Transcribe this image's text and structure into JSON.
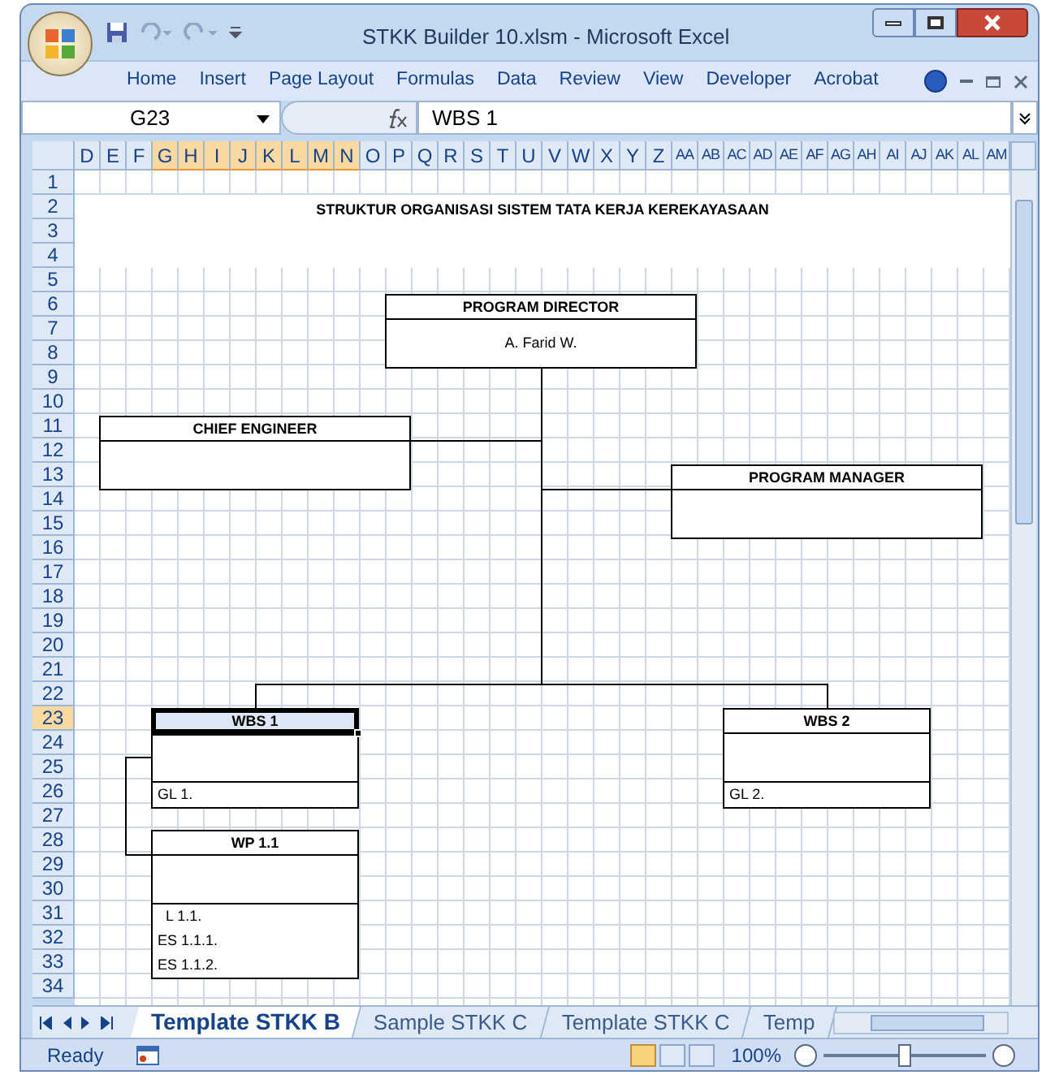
{
  "window": {
    "title": "STKK Builder 10.xlsm  -  Microsoft Excel"
  },
  "ribbon_tabs": [
    {
      "label": "Home"
    },
    {
      "label": "Insert"
    },
    {
      "label": "Page Layout"
    },
    {
      "label": "Formulas"
    },
    {
      "label": "Data"
    },
    {
      "label": "Review"
    },
    {
      "label": "View"
    },
    {
      "label": "Developer"
    },
    {
      "label": "Acrobat"
    }
  ],
  "formula_bar": {
    "name_box": "G23",
    "formula": "WBS 1"
  },
  "columns": [
    {
      "label": "D",
      "selected": false
    },
    {
      "label": "E",
      "selected": false
    },
    {
      "label": "F",
      "selected": false
    },
    {
      "label": "G",
      "selected": true
    },
    {
      "label": "H",
      "selected": true
    },
    {
      "label": "I",
      "selected": true
    },
    {
      "label": "J",
      "selected": true
    },
    {
      "label": "K",
      "selected": true
    },
    {
      "label": "L",
      "selected": true
    },
    {
      "label": "M",
      "selected": true
    },
    {
      "label": "N",
      "selected": true
    },
    {
      "label": "O",
      "selected": false
    },
    {
      "label": "P",
      "selected": false
    },
    {
      "label": "Q",
      "selected": false
    },
    {
      "label": "R",
      "selected": false
    },
    {
      "label": "S",
      "selected": false
    },
    {
      "label": "T",
      "selected": false
    },
    {
      "label": "U",
      "selected": false
    },
    {
      "label": "V",
      "selected": false
    },
    {
      "label": "W",
      "selected": false
    },
    {
      "label": "X",
      "selected": false
    },
    {
      "label": "Y",
      "selected": false
    },
    {
      "label": "Z",
      "selected": false
    },
    {
      "label": "AA",
      "selected": false
    },
    {
      "label": "AB",
      "selected": false
    },
    {
      "label": "AC",
      "selected": false
    },
    {
      "label": "AD",
      "selected": false
    },
    {
      "label": "AE",
      "selected": false
    },
    {
      "label": "AF",
      "selected": false
    },
    {
      "label": "AG",
      "selected": false
    },
    {
      "label": "AH",
      "selected": false
    },
    {
      "label": "AI",
      "selected": false
    },
    {
      "label": "AJ",
      "selected": false
    },
    {
      "label": "AK",
      "selected": false
    },
    {
      "label": "AL",
      "selected": false
    },
    {
      "label": "AM",
      "selected": false
    }
  ],
  "rows": [
    {
      "label": "1",
      "selected": false
    },
    {
      "label": "2",
      "selected": false
    },
    {
      "label": "3",
      "selected": false
    },
    {
      "label": "4",
      "selected": false
    },
    {
      "label": "5",
      "selected": false
    },
    {
      "label": "6",
      "selected": false
    },
    {
      "label": "7",
      "selected": false
    },
    {
      "label": "8",
      "selected": false
    },
    {
      "label": "9",
      "selected": false
    },
    {
      "label": "10",
      "selected": false
    },
    {
      "label": "11",
      "selected": false
    },
    {
      "label": "12",
      "selected": false
    },
    {
      "label": "13",
      "selected": false
    },
    {
      "label": "14",
      "selected": false
    },
    {
      "label": "15",
      "selected": false
    },
    {
      "label": "16",
      "selected": false
    },
    {
      "label": "17",
      "selected": false
    },
    {
      "label": "18",
      "selected": false
    },
    {
      "label": "19",
      "selected": false
    },
    {
      "label": "20",
      "selected": false
    },
    {
      "label": "21",
      "selected": false
    },
    {
      "label": "22",
      "selected": false
    },
    {
      "label": "23",
      "selected": true
    },
    {
      "label": "24",
      "selected": false
    },
    {
      "label": "25",
      "selected": false
    },
    {
      "label": "26",
      "selected": false
    },
    {
      "label": "27",
      "selected": false
    },
    {
      "label": "28",
      "selected": false
    },
    {
      "label": "29",
      "selected": false
    },
    {
      "label": "30",
      "selected": false
    },
    {
      "label": "31",
      "selected": false
    },
    {
      "label": "32",
      "selected": false
    },
    {
      "label": "33",
      "selected": false
    },
    {
      "label": "34",
      "selected": false
    }
  ],
  "sheet_title": "STRUKTUR ORGANISASI SISTEM TATA KERJA KEREKAYASAAN",
  "boxes": [
    {
      "kind": "role",
      "title": "PROGRAM DIRECTOR",
      "body": "A. Farid W.",
      "selected": false
    },
    {
      "kind": "role",
      "title": "CHIEF ENGINEER",
      "selected": false
    },
    {
      "kind": "role",
      "title": "PROGRAM MANAGER",
      "selected": false
    },
    {
      "kind": "package",
      "title": "WBS 1",
      "footer": [
        "GL 1."
      ],
      "selected": true
    },
    {
      "kind": "package",
      "title": "WBS 2",
      "footer": [
        "GL 2."
      ],
      "selected": false
    },
    {
      "kind": "package",
      "title": "WP 1.1",
      "footer": [
        "L 1.1.",
        "ES 1.1.1.",
        "ES 1.1.2."
      ],
      "selected": false
    }
  ],
  "sheet_tabs": [
    {
      "label": "Template STKK B",
      "selected": true
    },
    {
      "label": "Sample STKK C",
      "selected": false
    },
    {
      "label": "Template STKK C",
      "selected": false
    },
    {
      "label": "Temp",
      "selected": false
    }
  ],
  "status_bar": {
    "status": "Ready",
    "zoom": "100%",
    "zoom_level": {
      "level": 0.5
    }
  }
}
